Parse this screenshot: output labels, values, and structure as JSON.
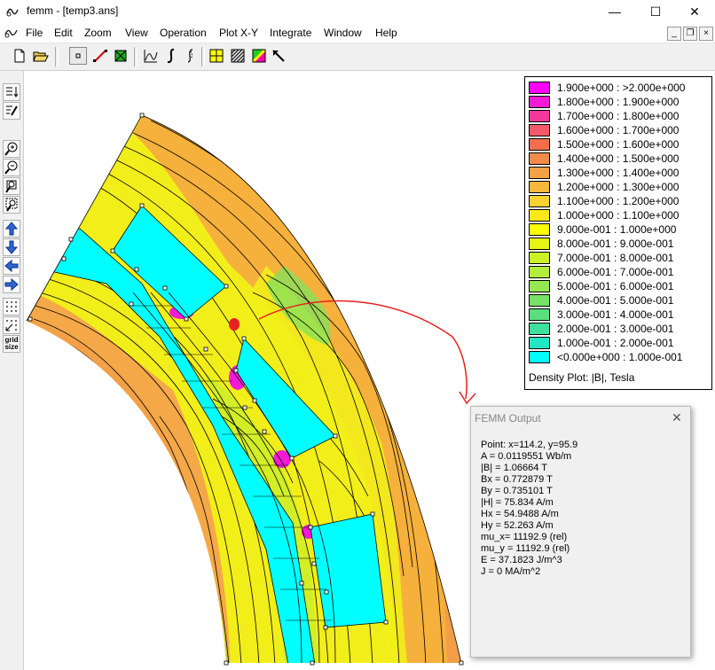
{
  "window": {
    "title": "femm - [temp3.ans]",
    "minimize": "—",
    "maximize": "☐",
    "close": "✕"
  },
  "menu": [
    "File",
    "Edit",
    "Zoom",
    "View",
    "Operation",
    "Plot X-Y",
    "Integrate",
    "Window",
    "Help"
  ],
  "mdi": {
    "minimize": "_",
    "restore": "❐",
    "close": "×"
  },
  "sidebar": {
    "grid_size_label": "grid size"
  },
  "legend": {
    "caption": "Density Plot: |B|, Tesla",
    "entries": [
      {
        "label": "1.900e+000 : >2.000e+000",
        "color": "#ff00ff"
      },
      {
        "label": "1.800e+000 : 1.900e+000",
        "color": "#f21ad6"
      },
      {
        "label": "1.700e+000 : 1.800e+000",
        "color": "#f2389a"
      },
      {
        "label": "1.600e+000 : 1.700e+000",
        "color": "#f25a6a"
      },
      {
        "label": "1.500e+000 : 1.600e+000",
        "color": "#f46e4e"
      },
      {
        "label": "1.400e+000 : 1.500e+000",
        "color": "#f28a4a"
      },
      {
        "label": "1.300e+000 : 1.400e+000",
        "color": "#f5a246"
      },
      {
        "label": "1.200e+000 : 1.300e+000",
        "color": "#f8b83e"
      },
      {
        "label": "1.100e+000 : 1.200e+000",
        "color": "#fbd232"
      },
      {
        "label": "1.000e+000 : 1.100e+000",
        "color": "#fde81a"
      },
      {
        "label": "9.000e-001 : 1.000e+000",
        "color": "#ffff00"
      },
      {
        "label": "8.000e-001 : 9.000e-001",
        "color": "#e6f514"
      },
      {
        "label": "7.000e-001 : 8.000e-001",
        "color": "#ccf028"
      },
      {
        "label": "6.000e-001 : 7.000e-001",
        "color": "#b2ec3c"
      },
      {
        "label": "5.000e-001 : 6.000e-001",
        "color": "#96e650"
      },
      {
        "label": "4.000e-001 : 5.000e-001",
        "color": "#78e266"
      },
      {
        "label": "3.000e-001 : 4.000e-001",
        "color": "#5ade80"
      },
      {
        "label": "2.000e-001 : 3.000e-001",
        "color": "#3ee09e"
      },
      {
        "label": "1.000e-001 : 2.000e-001",
        "color": "#22e6c6"
      },
      {
        "label": "<0.000e+000 : 1.000e-001",
        "color": "#00ffff"
      }
    ]
  },
  "output": {
    "title": "FEMM Output",
    "close": "✕",
    "lines": [
      "Point: x=114.2, y=95.9",
      "A    = 0.0119551 Wb/m",
      "|B| = 1.06664 T",
      "Bx   = 0.772879 T",
      "By   = 0.735101 T",
      "|H| = 75.834 A/m",
      "Hx   = 54.9488 A/m",
      "Hy   = 52.263 A/m",
      "mu_x= 11192.9 (rel)",
      "mu_y = 11192.9 (rel)",
      "E    = 37.1823 J/m^3",
      "J    = 0 MA/m^2"
    ]
  },
  "colors": {
    "iron_orange": "#f4a24a",
    "iron_yellow": "#f2ee1a",
    "slot": "#00ffff",
    "annotation": "#e82020"
  }
}
